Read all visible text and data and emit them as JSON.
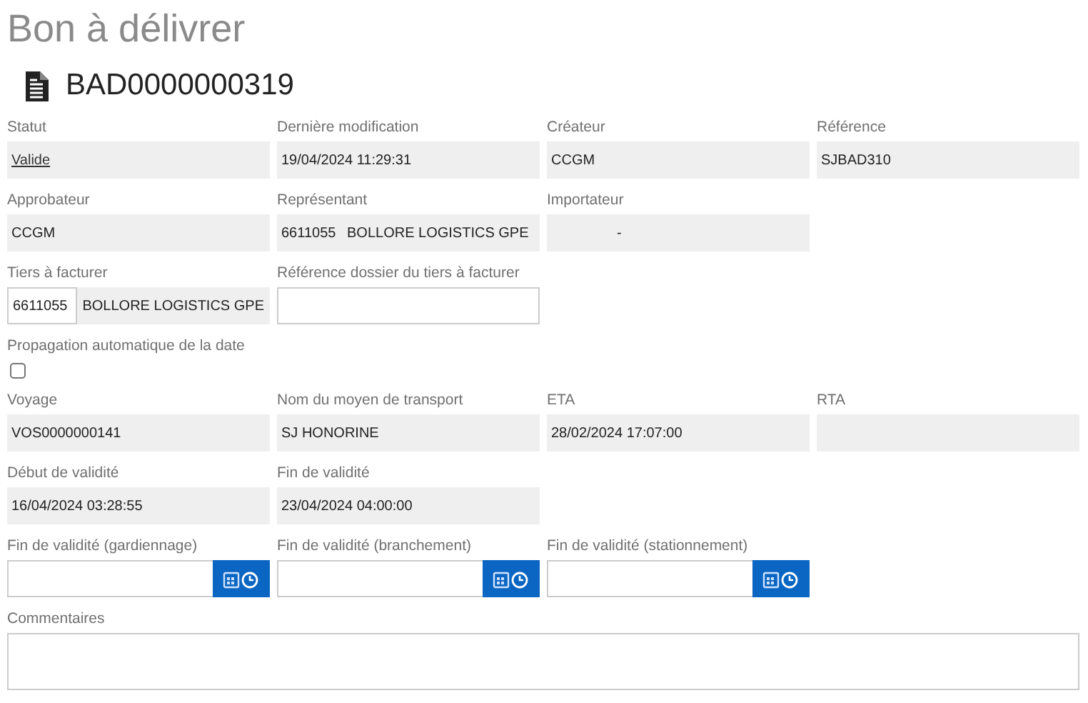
{
  "title": "Bon à délivrer",
  "record": {
    "number": "BAD0000000319"
  },
  "rows": [
    {
      "fields": [
        {
          "kind": "link",
          "label": "Statut",
          "value": "Valide"
        },
        {
          "kind": "readonly",
          "label": "Dernière modification",
          "value": "19/04/2024 11:29:31"
        },
        {
          "kind": "readonly",
          "label": "Créateur",
          "value": "CCGM"
        },
        {
          "kind": "readonly",
          "label": "Référence",
          "value": "SJBAD310"
        }
      ]
    },
    {
      "fields": [
        {
          "kind": "readonly",
          "label": "Approbateur",
          "value": "CCGM"
        },
        {
          "kind": "pair",
          "label": "Représentant",
          "code": "6611055",
          "name": "BOLLORE LOGISTICS GPE"
        },
        {
          "kind": "pair",
          "label": "Importateur",
          "name": "-"
        }
      ]
    },
    {
      "fields": [
        {
          "kind": "split",
          "label": "Tiers à facturer",
          "code": "6611055",
          "name": "BOLLORE LOGISTICS GPE"
        },
        {
          "kind": "input",
          "label": "Référence dossier du tiers à facturer"
        }
      ]
    },
    {
      "fields": [
        {
          "kind": "checkbox",
          "label": "Propagation automatique de la date",
          "checked": false
        }
      ]
    },
    {
      "fields": [
        {
          "kind": "readonly",
          "label": "Voyage",
          "value": "VOS0000000141"
        },
        {
          "kind": "readonly",
          "label": "Nom du moyen de transport",
          "value": "SJ HONORINE"
        },
        {
          "kind": "readonly",
          "label": "ETA",
          "value": "28/02/2024 17:07:00"
        },
        {
          "kind": "readonly",
          "label": "RTA"
        }
      ]
    },
    {
      "fields": [
        {
          "kind": "readonly",
          "label": "Début de validité",
          "value": "16/04/2024 03:28:55"
        },
        {
          "kind": "readonly",
          "label": "Fin de validité",
          "value": "23/04/2024 04:00:00"
        }
      ]
    },
    {
      "fields": [
        {
          "kind": "datetime",
          "label": "Fin de validité (gardiennage)"
        },
        {
          "kind": "datetime",
          "label": "Fin de validité (branchement)"
        },
        {
          "kind": "datetime",
          "label": "Fin de validité (stationnement)"
        }
      ]
    },
    {
      "fields": [
        {
          "kind": "textarea",
          "label": "Commentaires"
        }
      ]
    }
  ]
}
